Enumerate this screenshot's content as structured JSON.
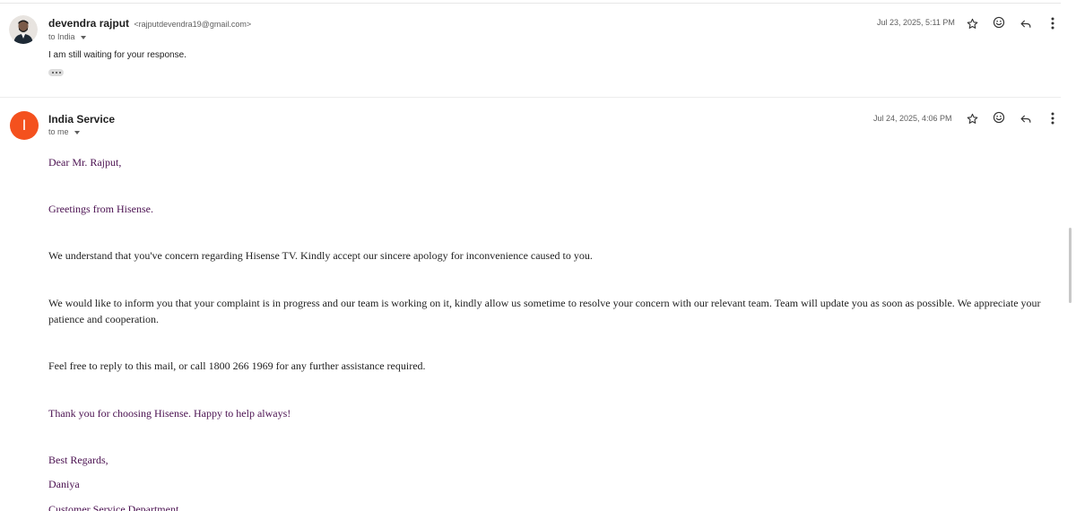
{
  "messages": [
    {
      "sender_name": "devendra rajput",
      "sender_email": "<rajputdevendra19@gmail.com>",
      "recipient": "to India",
      "date": "Jul 23, 2025, 5:11 PM",
      "preview": "I am still waiting for your response.",
      "avatar_icon": "user-photo-avatar"
    },
    {
      "sender_name": "India Service",
      "avatar_letter": "I",
      "avatar_color": "#f4511e",
      "recipient": "to me",
      "date": "Jul 24, 2025, 4:06 PM",
      "body": {
        "greeting": "Dear Mr. Rajput,",
        "line1": "Greetings from Hisense.",
        "line2": "We understand that you've concern regarding Hisense TV. Kindly accept our sincere apology for inconvenience caused to you.",
        "line3": "We would like to inform you that your complaint is in progress and our team is working on it, kindly allow us sometime to resolve your concern with our relevant team. Team will update you as soon as possible. We appreciate your patience and cooperation.",
        "line4": "Feel free to reply to this mail, or call 1800 266 1969  for any further assistance required.",
        "line5": "Thank you for choosing Hisense. Happy to help always!",
        "regards": "Best Regards,",
        "signature_name": "Daniya",
        "department": "Customer Service Department"
      }
    }
  ],
  "icons": {
    "star": "star-icon",
    "emoji": "emoji-icon",
    "reply": "reply-icon",
    "more": "more-vert-icon"
  },
  "colors": {
    "accent_purple": "#4a1050",
    "avatar_orange": "#f4511e"
  }
}
